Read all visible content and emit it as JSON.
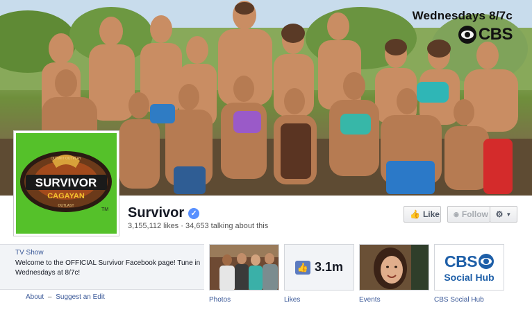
{
  "cover": {
    "tagline": "Wednesdays  8/7c",
    "network_logo": "CBS"
  },
  "profile": {
    "logo_title": "SURVIVOR",
    "logo_subtitle": "CAGAYAN",
    "logo_top_text": "OUTWIT OUTPLAY",
    "logo_bottom_text": "OUTLAST",
    "logo_tm": "TM"
  },
  "page": {
    "name": "Survivor",
    "verified_icon": "check-icon",
    "stats": "3,155,112 likes · 34,653 talking about this"
  },
  "actions": {
    "like_label": "Like",
    "follow_label": "Follow"
  },
  "info": {
    "category": "TV Show",
    "description": "Welcome to the OFFICIAL Survivor Facebook page! Tune in Wednesdays at 8/7c!",
    "about_link": "About",
    "separator": "–",
    "suggest_edit_link": "Suggest an Edit"
  },
  "tiles": [
    {
      "label": "Photos"
    },
    {
      "label": "Likes",
      "count": "3.1m"
    },
    {
      "label": "Events"
    },
    {
      "label": "CBS Social Hub",
      "logo_word": "CBS",
      "logo_sub": "Social Hub"
    }
  ],
  "colors": {
    "link": "#3b5998",
    "verified": "#5890ff",
    "logo_green": "#55c12a",
    "cbs_blue": "#1e5fa8"
  }
}
